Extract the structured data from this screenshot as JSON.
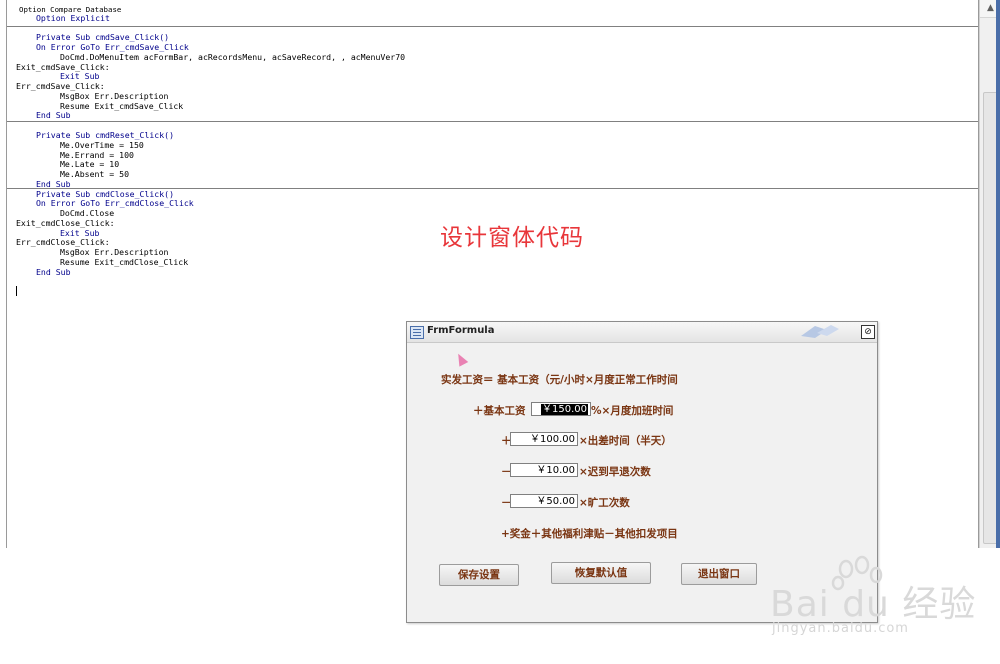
{
  "code": {
    "header": [
      "Option Compare Database",
      "Option Explicit"
    ],
    "save_proc": [
      "Private Sub cmdSave_Click()",
      "On Error GoTo Err_cmdSave_Click",
      "DoCmd.DoMenuItem acFormBar, acRecordsMenu, acSaveRecord, , acMenuVer70",
      "Exit_cmdSave_Click:",
      "Exit Sub",
      "Err_cmdSave_Click:",
      "MsgBox Err.Description",
      "Resume Exit_cmdSave_Click",
      "End Sub"
    ],
    "reset_proc": [
      "Private Sub cmdReset_Click()",
      "Me.OverTime = 150",
      "Me.Errand = 100",
      "Me.Late = 10",
      "Me.Absent = 50",
      "End Sub"
    ],
    "close_proc": [
      "Private Sub cmdClose_Click()",
      "On Error GoTo Err_cmdClose_Click",
      "DoCmd.Close",
      "Exit_cmdClose_Click:",
      "Exit Sub",
      "Err_cmdClose_Click:",
      "MsgBox Err.Description",
      "Resume Exit_cmdClose_Click",
      "End Sub"
    ]
  },
  "caption": "设计窗体代码",
  "form": {
    "title": "FrmFormula",
    "close_glyph": "⊘",
    "formula_heading": "实发工资＝ 基本工资（元/小时×月度正常工作时间",
    "row1_prefix": "＋基本工资",
    "row1_value": "￥150.00",
    "row1_suffix": "%×月度加班时间",
    "row2_prefix": "＋",
    "row2_value": "￥100.00",
    "row2_suffix": "×出差时间（半天）",
    "row3_prefix": "－",
    "row3_value": "￥10.00",
    "row3_suffix": "×迟到早退次数",
    "row4_prefix": "－",
    "row4_value": "￥50.00",
    "row4_suffix": "×旷工次数",
    "footer_line": "+奖金＋其他福利津贴－其他扣发项目",
    "btn_save": "保存设置",
    "btn_reset": "恢复默认值",
    "btn_close": "退出窗口"
  },
  "watermark": {
    "text": "Bai du 经验",
    "url": "jingyan.baidu.com"
  },
  "colors": {
    "caption": "#e8363a",
    "form_label": "#7a3512",
    "keyword": "#00008b"
  }
}
